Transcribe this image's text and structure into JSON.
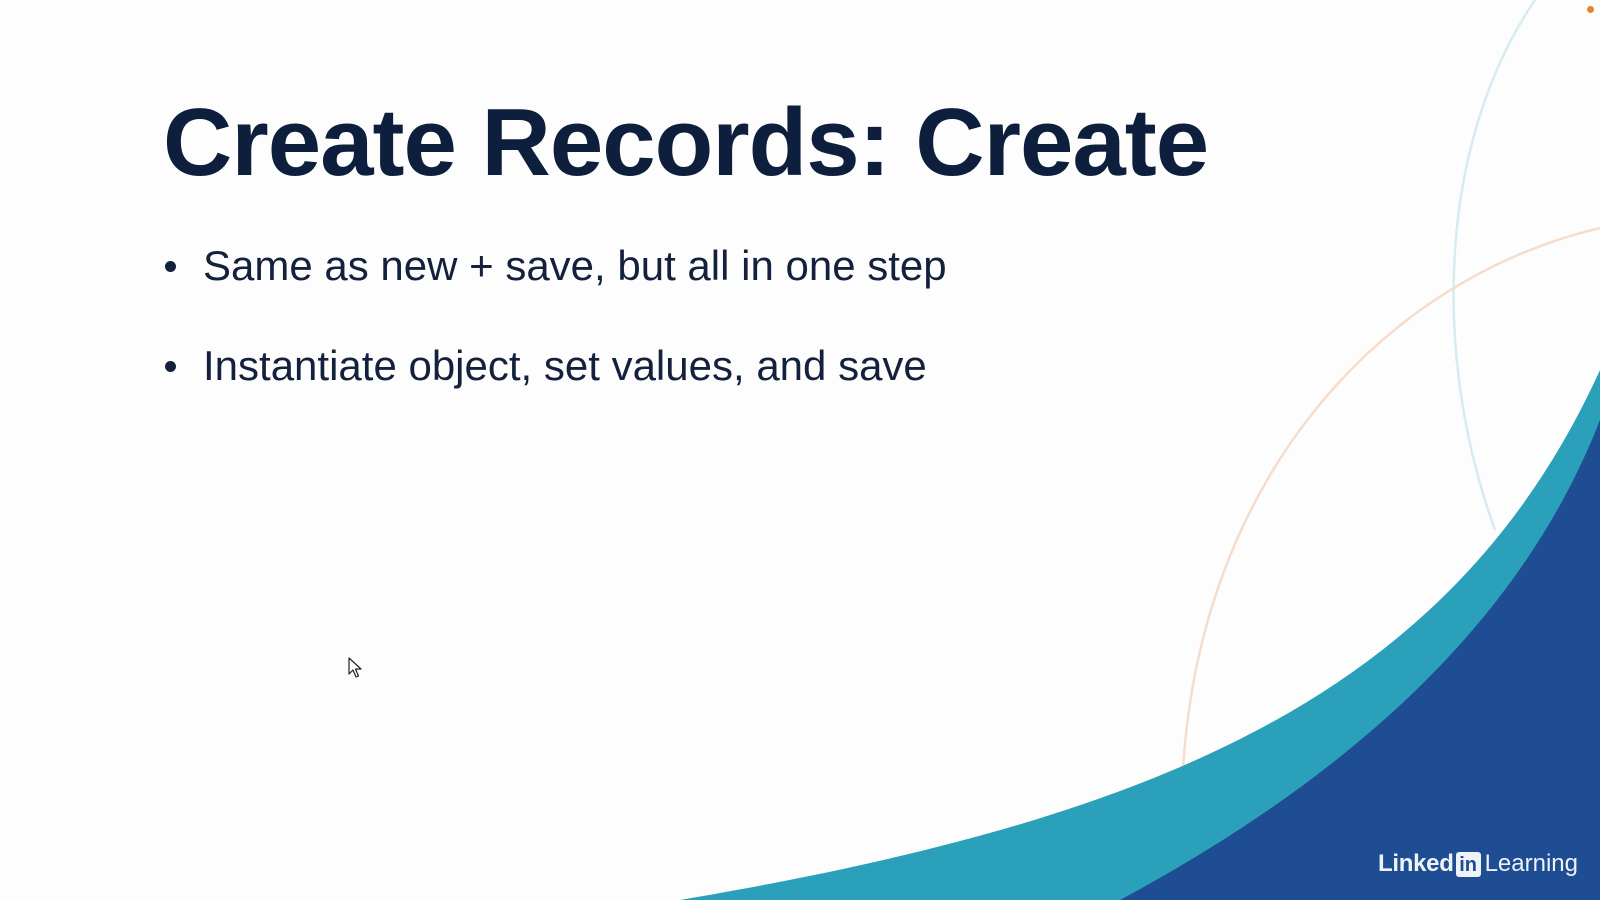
{
  "slide": {
    "title": "Create Records: Create",
    "bullets": [
      "Same as new + save, but all in one step",
      "Instantiate object, set values, and save"
    ]
  },
  "branding": {
    "linked": "Linked",
    "in": "in",
    "learning": "Learning"
  },
  "colors": {
    "title": "#0d1f3c",
    "text": "#14213d",
    "teal_wave": "#2aa0bb",
    "blue_wave": "#1e4d93",
    "light_arc": "#d6ecf2",
    "peach_arc": "#f6dccb",
    "recording_dot": "#e8852a"
  },
  "icons": {
    "cursor": "mouse-pointer-icon",
    "brand_logo": "linkedin-in-icon"
  }
}
